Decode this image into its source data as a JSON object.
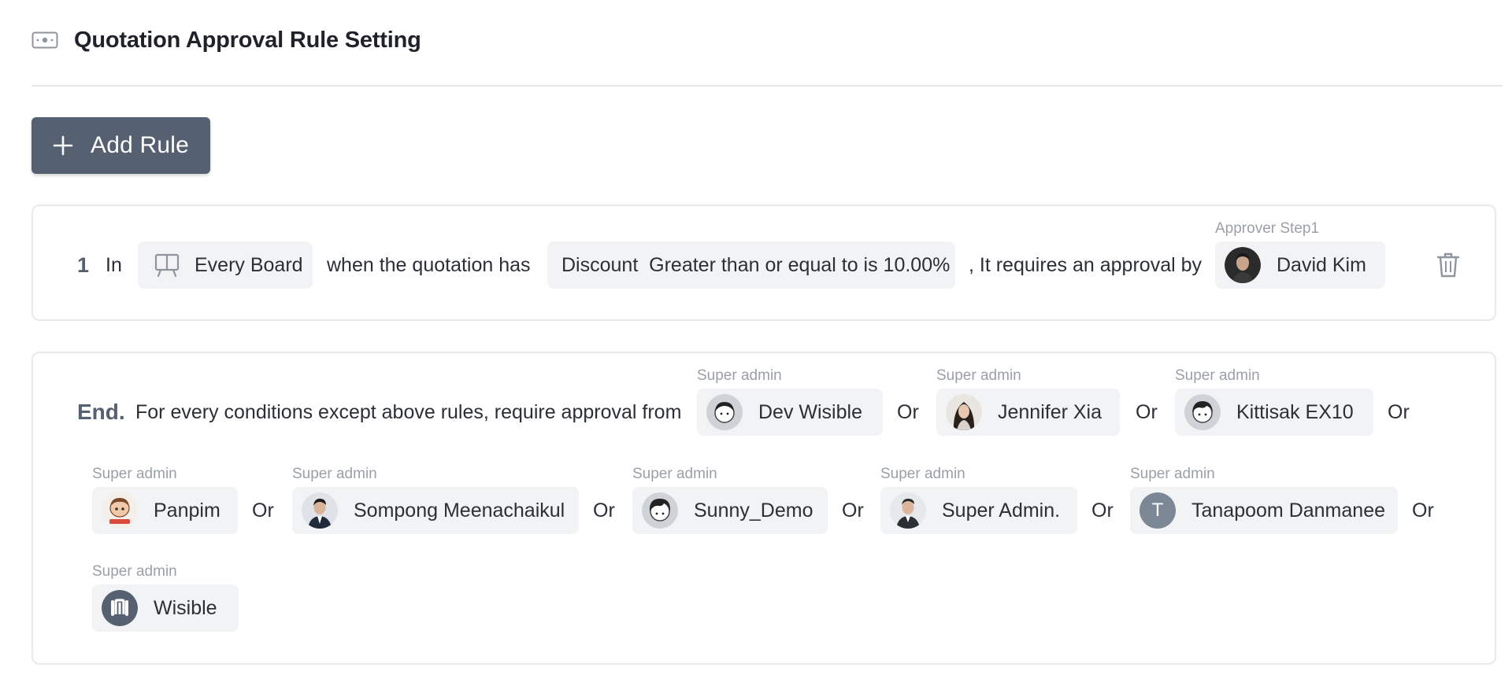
{
  "header": {
    "title": "Quotation Approval Rule Setting",
    "icon": "money-icon"
  },
  "add_rule": {
    "label": "Add Rule",
    "icon": "plus-icon"
  },
  "rule": {
    "number": "1",
    "in_text": "In",
    "board": {
      "label": "Every Board",
      "icon": "board-icon"
    },
    "when_text": "when the quotation has",
    "condition": "Discount  Greater than or equal to is 10.00%",
    "requires_text": ", It requires an approval by",
    "approver": {
      "caption": "Approver Step1",
      "name": "David Kim"
    },
    "delete_icon": "trash-icon"
  },
  "end": {
    "label": "End.",
    "text": "For every conditions except above rules, require approval from",
    "or_label": "Or",
    "approvers": [
      {
        "role": "Super admin",
        "name": "Dev Wisible"
      },
      {
        "role": "Super admin",
        "name": "Jennifer Xia"
      },
      {
        "role": "Super admin",
        "name": "Kittisak EX10"
      },
      {
        "role": "Super admin",
        "name": "Panpim"
      },
      {
        "role": "Super admin",
        "name": "Sompong Meenachaikul"
      },
      {
        "role": "Super admin",
        "name": "Sunny_Demo"
      },
      {
        "role": "Super admin",
        "name": "Super Admin."
      },
      {
        "role": "Super admin",
        "name": "Tanapoom Danmanee",
        "initial": "T"
      },
      {
        "role": "Super admin",
        "name": "Wisible"
      }
    ]
  },
  "colors": {
    "button_bg": "#556170",
    "chip_bg": "#f2f3f5",
    "caption": "#9aa0a8",
    "border": "#e8eaed"
  }
}
